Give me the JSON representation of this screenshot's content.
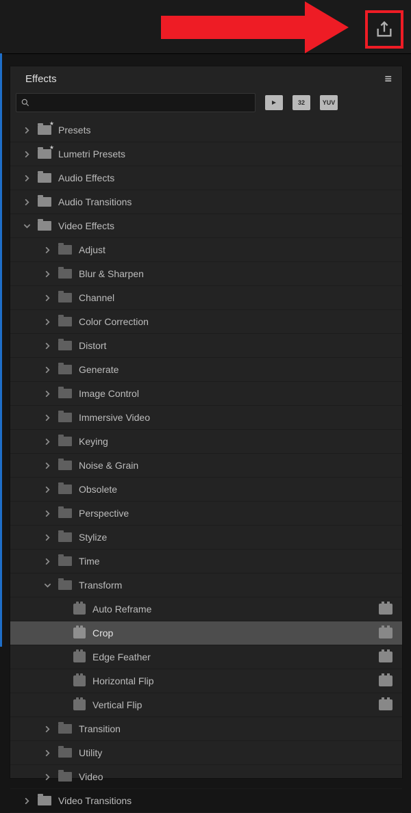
{
  "panel": {
    "title": "Effects"
  },
  "search": {
    "placeholder": ""
  },
  "toolbar": {
    "btn1": "",
    "btn2": "32",
    "btn3": "YUV"
  },
  "tree": {
    "presets": "Presets",
    "lumetri": "Lumetri Presets",
    "audioEffects": "Audio Effects",
    "audioTransitions": "Audio Transitions",
    "videoEffects": "Video Effects",
    "ve": {
      "adjust": "Adjust",
      "blur": "Blur & Sharpen",
      "channel": "Channel",
      "color": "Color Correction",
      "distort": "Distort",
      "generate": "Generate",
      "imageControl": "Image Control",
      "immersive": "Immersive Video",
      "keying": "Keying",
      "noise": "Noise & Grain",
      "obsolete": "Obsolete",
      "perspective": "Perspective",
      "stylize": "Stylize",
      "time": "Time",
      "transform": "Transform",
      "tf": {
        "autoReframe": "Auto Reframe",
        "crop": "Crop",
        "edgeFeather": "Edge Feather",
        "horizontalFlip": "Horizontal Flip",
        "verticalFlip": "Vertical Flip"
      },
      "transition": "Transition",
      "utility": "Utility",
      "video": "Video"
    },
    "videoTransitions": "Video Transitions"
  }
}
